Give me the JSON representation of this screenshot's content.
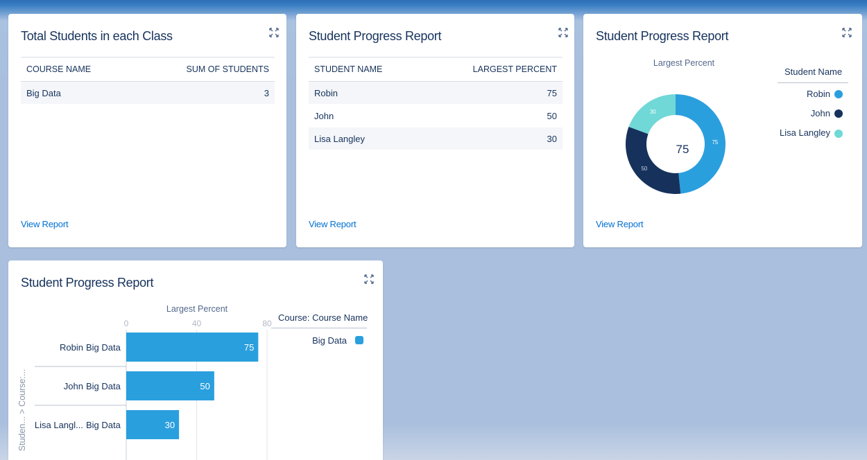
{
  "colors": {
    "accent_link": "#0070d2",
    "robin": "#2a9fde",
    "john": "#16325c",
    "lisa": "#70d8d6",
    "bar": "#2a9fde"
  },
  "card1": {
    "title": "Total Students in each Class",
    "expand_icon": "expand-icon",
    "columns": [
      "COURSE NAME",
      "SUM OF STUDENTS"
    ],
    "rows": [
      {
        "course": "Big Data",
        "sum": "3"
      }
    ],
    "view_report": "View Report"
  },
  "card2": {
    "title": "Student Progress Report",
    "columns": [
      "STUDENT NAME",
      "LARGEST PERCENT"
    ],
    "rows": [
      {
        "name": "Robin",
        "percent": "75"
      },
      {
        "name": "John",
        "percent": "50"
      },
      {
        "name": "Lisa Langley",
        "percent": "30"
      }
    ],
    "view_report": "View Report"
  },
  "card3": {
    "title": "Student Progress Report",
    "legend_title": "Student Name",
    "legend": [
      "Robin",
      "John",
      "Lisa Langley"
    ],
    "view_report": "View Report"
  },
  "card4": {
    "title": "Student Progress Report",
    "legend_title": "Course: Course Name",
    "legend": [
      "Big Data"
    ]
  },
  "chart_data": [
    {
      "type": "pie",
      "title": "Largest Percent",
      "center_label": "75",
      "categories": [
        "Robin",
        "John",
        "Lisa Langley"
      ],
      "values": [
        75,
        50,
        30
      ],
      "colors": [
        "#2a9fde",
        "#16325c",
        "#70d8d6"
      ],
      "legend": "right"
    },
    {
      "type": "bar",
      "orientation": "horizontal",
      "title": "Largest Percent",
      "ylabel": "Studen... > Course:...",
      "categories": [
        {
          "student": "Robin",
          "course": "Big Data"
        },
        {
          "student": "John",
          "course": "Big Data"
        },
        {
          "student": "Lisa Langl...",
          "course": "Big Data"
        }
      ],
      "values": [
        75,
        50,
        30
      ],
      "xlim": [
        0,
        80
      ],
      "xticks": [
        "0",
        "40",
        "80"
      ],
      "series": [
        {
          "name": "Big Data",
          "values": [
            75,
            50,
            30
          ]
        }
      ],
      "legend": "right"
    }
  ]
}
